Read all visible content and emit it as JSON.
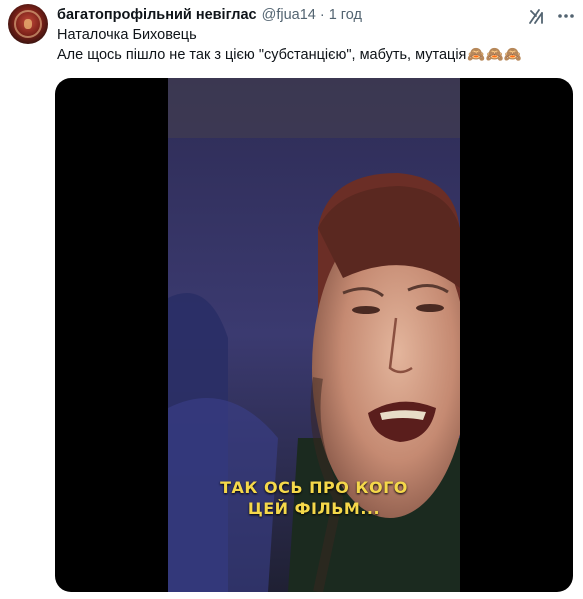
{
  "tweet": {
    "display_name": "багатопрофільний невіглас",
    "handle": "@fjua14",
    "separator": "·",
    "time": "1 год",
    "text_line1": "Наталочка Биховець",
    "text_line2": "Але щось пішло не так з цією \"субстанцією\", мабуть, мутація",
    "emoji": "🙈🙈🙈"
  },
  "media": {
    "caption_line1": "ТАК ОСЬ ПРО КОГО",
    "caption_line2": "ЦЕЙ ФІЛЬМ..."
  },
  "icons": {
    "grok": "grok-icon",
    "more": "more-icon"
  },
  "colors": {
    "text": "#0f1419",
    "secondary": "#536471",
    "caption": "#f5d84a",
    "media_bg": "#000000"
  }
}
